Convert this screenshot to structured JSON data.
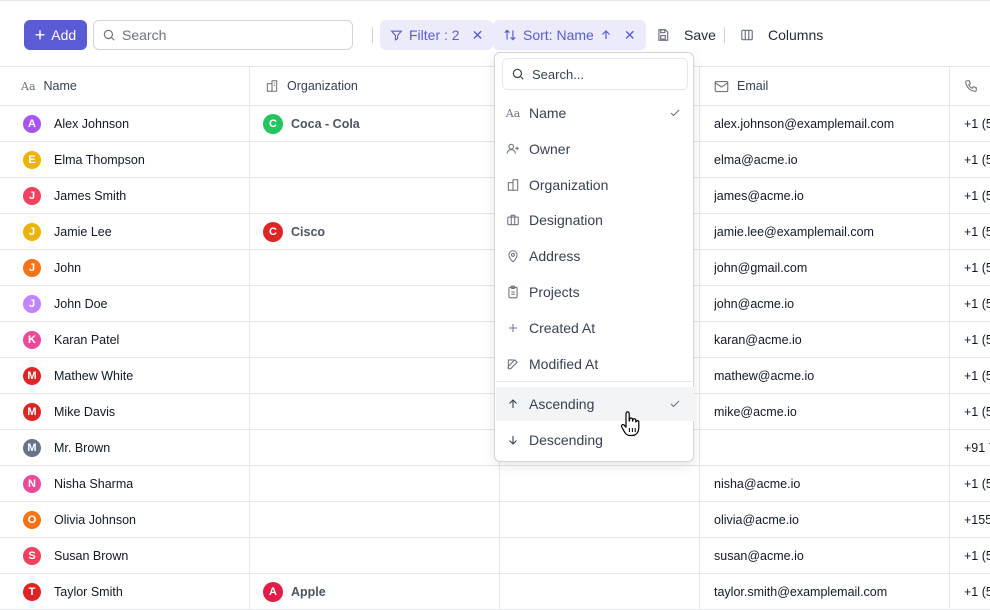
{
  "toolbar": {
    "add_label": "Add",
    "search_placeholder": "Search",
    "filter_label": "Filter : 2",
    "sort_label": "Sort: Name",
    "save_label": "Save",
    "columns_label": "Columns"
  },
  "columns": {
    "name": "Name",
    "organization": "Organization",
    "email": "Email"
  },
  "rows": [
    {
      "initial": "A",
      "color": "#a855f7",
      "name": "Alex Johnson",
      "org_initial": "C",
      "org_color": "#22c55e",
      "org": "Coca - Cola",
      "email": "alex.johnson@examplemail.com",
      "phone": "+1 (5"
    },
    {
      "initial": "E",
      "color": "#eab308",
      "name": "Elma Thompson",
      "org_initial": "",
      "org_color": "",
      "org": "",
      "email": "elma@acme.io",
      "phone": "+1 (5"
    },
    {
      "initial": "J",
      "color": "#f43f5e",
      "name": "James Smith",
      "org_initial": "",
      "org_color": "",
      "org": "",
      "email": "james@acme.io",
      "phone": "+1 (5"
    },
    {
      "initial": "J",
      "color": "#eab308",
      "name": "Jamie Lee",
      "org_initial": "C",
      "org_color": "#dc2626",
      "org": "Cisco",
      "email": "jamie.lee@examplemail.com",
      "phone": "+1 (5"
    },
    {
      "initial": "J",
      "color": "#f97316",
      "name": "John",
      "org_initial": "",
      "org_color": "",
      "org": "",
      "email": "john@gmail.com",
      "phone": "+1 (5"
    },
    {
      "initial": "J",
      "color": "#c084fc",
      "name": "John Doe",
      "org_initial": "",
      "org_color": "",
      "org": "",
      "email": "john@acme.io",
      "phone": "+1 (5"
    },
    {
      "initial": "K",
      "color": "#ec4899",
      "name": "Karan Patel",
      "org_initial": "",
      "org_color": "",
      "org": "",
      "email": "karan@acme.io",
      "phone": "+1 (5"
    },
    {
      "initial": "M",
      "color": "#dc2626",
      "name": "Mathew White",
      "org_initial": "",
      "org_color": "",
      "org": "",
      "email": "mathew@acme.io",
      "phone": "+1 (5"
    },
    {
      "initial": "M",
      "color": "#dc2626",
      "name": "Mike Davis",
      "org_initial": "",
      "org_color": "",
      "org": "",
      "email": "mike@acme.io",
      "phone": "+1 (5"
    },
    {
      "initial": "M",
      "color": "#64748b",
      "name": "Mr. Brown",
      "org_initial": "",
      "org_color": "",
      "org": "",
      "email": "",
      "phone": "+91 7"
    },
    {
      "initial": "N",
      "color": "#ec4899",
      "name": "Nisha Sharma",
      "org_initial": "",
      "org_color": "",
      "org": "",
      "email": "nisha@acme.io",
      "phone": "+1 (5"
    },
    {
      "initial": "O",
      "color": "#f97316",
      "name": "Olivia Johnson",
      "org_initial": "",
      "org_color": "",
      "org": "",
      "email": "olivia@acme.io",
      "phone": "+155"
    },
    {
      "initial": "S",
      "color": "#f43f5e",
      "name": "Susan Brown",
      "org_initial": "",
      "org_color": "",
      "org": "",
      "email": "susan@acme.io",
      "phone": "+1 (5"
    },
    {
      "initial": "T",
      "color": "#dc2626",
      "name": "Taylor Smith",
      "org_initial": "A",
      "org_color": "#e11d48",
      "org": "Apple",
      "email": "taylor.smith@examplemail.com",
      "phone": "+1 (5"
    }
  ],
  "sort_menu": {
    "search_placeholder": "Search...",
    "fields": [
      {
        "label": "Name",
        "icon": "text-aa-icon",
        "checked": true
      },
      {
        "label": "Owner",
        "icon": "user-plus-icon",
        "checked": false
      },
      {
        "label": "Organization",
        "icon": "building-icon",
        "checked": false
      },
      {
        "label": "Designation",
        "icon": "briefcase-icon",
        "checked": false
      },
      {
        "label": "Address",
        "icon": "map-pin-icon",
        "checked": false
      },
      {
        "label": "Projects",
        "icon": "clipboard-icon",
        "checked": false
      },
      {
        "label": "Created At",
        "icon": "plus-icon",
        "checked": false
      },
      {
        "label": "Modified At",
        "icon": "edit-icon",
        "checked": false
      }
    ],
    "directions": [
      {
        "label": "Ascending",
        "icon": "arrow-up-icon",
        "checked": true
      },
      {
        "label": "Descending",
        "icon": "arrow-down-icon",
        "checked": false
      }
    ]
  },
  "colors": {
    "accent": "#5b5bd6",
    "accent_soft": "#ebebfb"
  }
}
